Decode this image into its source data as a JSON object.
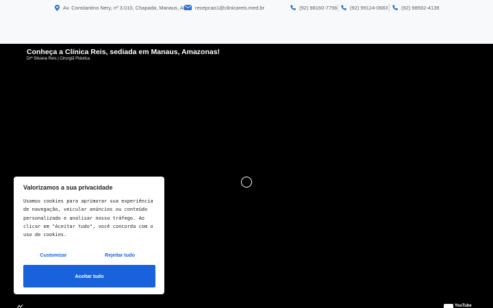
{
  "topbar": {
    "address": "Av. Constantino Nery, nº 3.010, Chapada, Manaus, AM",
    "email": "recepcao1@clinicareis.med.br",
    "phones": [
      "(92) 98160-7756",
      "(92) 99124-0683",
      "(92) 98592-4139"
    ]
  },
  "video": {
    "title": "Conheça a Clínica Reis, sediada em Manaus, Amazonas!",
    "subtitle": "Drª Silvana Reis | Cirurgiã Plástica",
    "brand": "YouTube"
  },
  "cookie": {
    "title": "Valorizamos a sua privacidade",
    "body": "Usamos cookies para aprimorar sua experiência de navegação, veicular anúncios ou conteúdo personalizado e analisar nosso tráfego. Ao clicar em \"Aceitar tudo\", você concorda com o uso de cookies.",
    "customize": "Customizar",
    "reject": "Rejeitar tudo",
    "accept": "Aceitar tudo"
  },
  "colors": {
    "accent": "#1863dc",
    "icon": "#2a6fc9",
    "topbar_bg": "#f8f9fa"
  },
  "icons": [
    "location-pin-icon",
    "envelope-icon",
    "phone-icon",
    "loading-spinner-icon",
    "youtube-logo-icon"
  ]
}
